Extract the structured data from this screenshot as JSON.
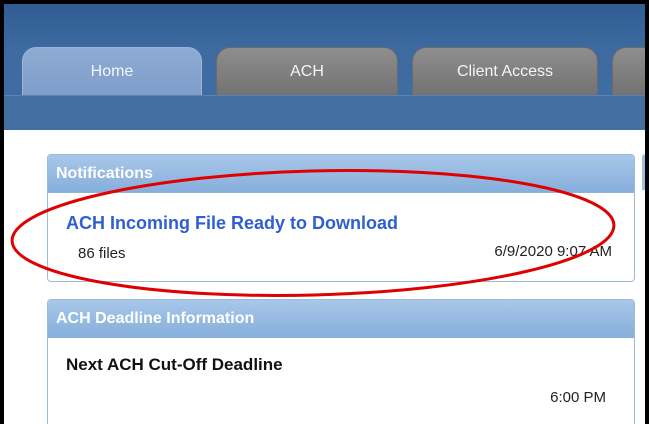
{
  "tabs": [
    {
      "label": "Home",
      "active": true
    },
    {
      "label": "ACH",
      "active": false
    },
    {
      "label": "Client Access",
      "active": false
    }
  ],
  "notifications": {
    "header": "Notifications",
    "item": {
      "title": "ACH Incoming File Ready to Download",
      "count": "86 files",
      "timestamp": "6/9/2020 9:07 AM"
    }
  },
  "deadline": {
    "header": "ACH Deadline Information",
    "title": "Next ACH Cut-Off Deadline",
    "time": "6:00 PM"
  },
  "colors": {
    "accent_blue": "#2f5fd1",
    "annotation_red": "#e00000",
    "header_bar": "#416ea3"
  }
}
